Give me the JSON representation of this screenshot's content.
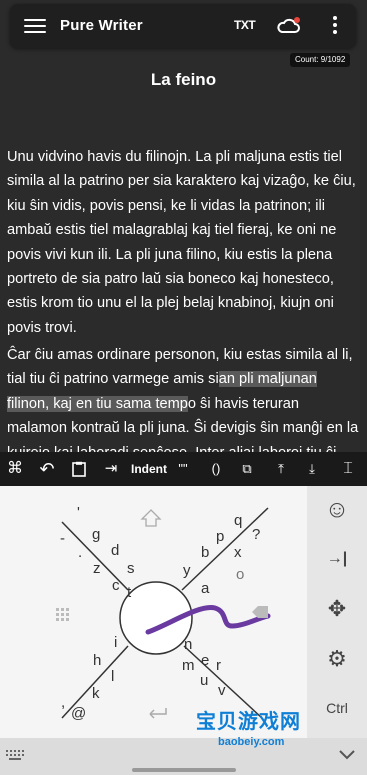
{
  "app": {
    "title": "Pure Writer",
    "txt_label": "TXT",
    "count": "Count: 9/1092"
  },
  "document": {
    "title": "La feino",
    "p1": "Unu vidvino havis du filinojn. La pli maljuna estis tiel simila al la patrino per sia karaktero kaj vizaĝo, ke ĉiu, kiu ŝin vidis, povis pensi, ke li vidas la patrinon; ili ambaŭ estis tiel malagrablaj kaj tiel fieraj, ke oni ne povis vivi kun ili. La pli juna filino, kiu estis la plena portreto de sia patro laŭ sia boneco kaj honesteco, estis krom tio unu el la plej belaj knabinoj, kiujn oni povis trovi.",
    "p2_before": "Ĉar ĉiu amas ordinare personon, kiu estas simila al li, tial tiu ĉi patrino varmege amis si",
    "p2_selected": "an pli maljunan filinon, kaj en tiu sama temp",
    "p2_after": "o ŝi havis teruran malamon kontraŭ la pli juna. Ŝi devigis ŝin manĝi en la kuirejo kaj laboradi senĉese. Inter aliaj laboroj tiu ĉi malfeliĉa infano devis du fojojn"
  },
  "toolbar": {
    "cmd": "⌘",
    "undo": "↶",
    "clipboard": "📋",
    "indent_icon": "⇥",
    "indent": "Indent",
    "quotes": "\"\"",
    "parens": "()",
    "copy": "⧉",
    "top": "⤒",
    "bottom": "⤓",
    "cursor": "⌶"
  },
  "keyboard": {
    "letters_ul": [
      "'",
      "g",
      "d",
      "z",
      "c",
      "s",
      "t"
    ],
    "letters_ur": [
      "?",
      "q",
      "x",
      "p",
      "b",
      "y",
      "a",
      "o"
    ],
    "letters_ll": [
      "i",
      "h",
      "l",
      "k",
      ",",
      "@"
    ],
    "letters_lr": [
      "n",
      "e",
      "m",
      "u",
      "r",
      "v"
    ],
    "extra": [
      "-",
      "."
    ],
    "side": {
      "emoji": "☺",
      "tab": "→|",
      "move": "✥",
      "settings": "⚙",
      "ctrl": "Ctrl"
    },
    "enter": "↵"
  },
  "watermark": {
    "cn": "宝贝游戏网",
    "url": "baobeiy.com"
  },
  "colors": {
    "editor_bg": "#2b2b2b",
    "selection": "#5a5a5a",
    "gesture_stroke": "#6a3aa0",
    "keyboard_bg": "#f5f5f5"
  }
}
